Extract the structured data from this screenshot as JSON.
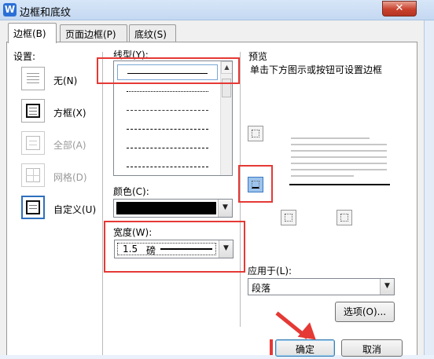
{
  "window": {
    "title": "边框和底纹",
    "app_icon_letter": "W",
    "close_glyph": "✕"
  },
  "tabs": [
    {
      "label": "边框(B)",
      "active": true
    },
    {
      "label": "页面边框(P)",
      "active": false
    },
    {
      "label": "底纹(S)",
      "active": false
    }
  ],
  "settings": {
    "title": "设置:",
    "items": [
      {
        "label": "无(N)",
        "enabled": true
      },
      {
        "label": "方框(X)",
        "enabled": true
      },
      {
        "label": "全部(A)",
        "enabled": false
      },
      {
        "label": "网格(D)",
        "enabled": false
      },
      {
        "label": "自定义(U)",
        "enabled": true
      }
    ]
  },
  "line_style": {
    "label": "线型(Y):"
  },
  "color": {
    "label": "颜色(C):",
    "value": "#000000"
  },
  "width": {
    "label": "宽度(W):",
    "value": "1.5",
    "unit": "磅"
  },
  "preview": {
    "title": "预览",
    "hint": "单击下方图示或按钮可设置边框"
  },
  "apply_to": {
    "label": "应用于(L):",
    "value": "段落"
  },
  "buttons": {
    "options": "选项(O)...",
    "ok": "确定",
    "cancel": "取消"
  },
  "colors": {
    "annotation_red": "#e53935",
    "selected_blue": "#9cc3ec"
  }
}
